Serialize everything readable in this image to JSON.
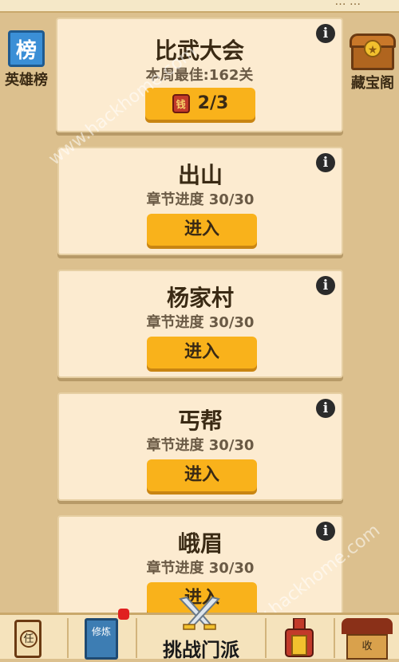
{
  "header": {
    "partial_text": "…  …"
  },
  "side_left": {
    "icon_char": "榜",
    "label": "英雄榜"
  },
  "side_right": {
    "icon_char": "★",
    "label": "藏宝阁"
  },
  "tournament": {
    "title": "比武大会",
    "subtitle": "本周最佳:162关",
    "coin_char": "钱",
    "attempts": "2/3"
  },
  "stages": [
    {
      "title": "出山",
      "progress": "章节进度 30/30",
      "button": "进入"
    },
    {
      "title": "杨家村",
      "progress": "章节进度 30/30",
      "button": "进入"
    },
    {
      "title": "丐帮",
      "progress": "章节进度 30/30",
      "button": "进入"
    },
    {
      "title": "峨眉",
      "progress": "章节进度 30/30",
      "button": "进入"
    }
  ],
  "info_char": "i",
  "bottom_nav": {
    "task_char": "任",
    "cultivate_text": "修炼",
    "center_label": "挑战门派",
    "shop_char": "收"
  },
  "watermarks": [
    "www.hackhome.com",
    "www.hackhome.com"
  ]
}
